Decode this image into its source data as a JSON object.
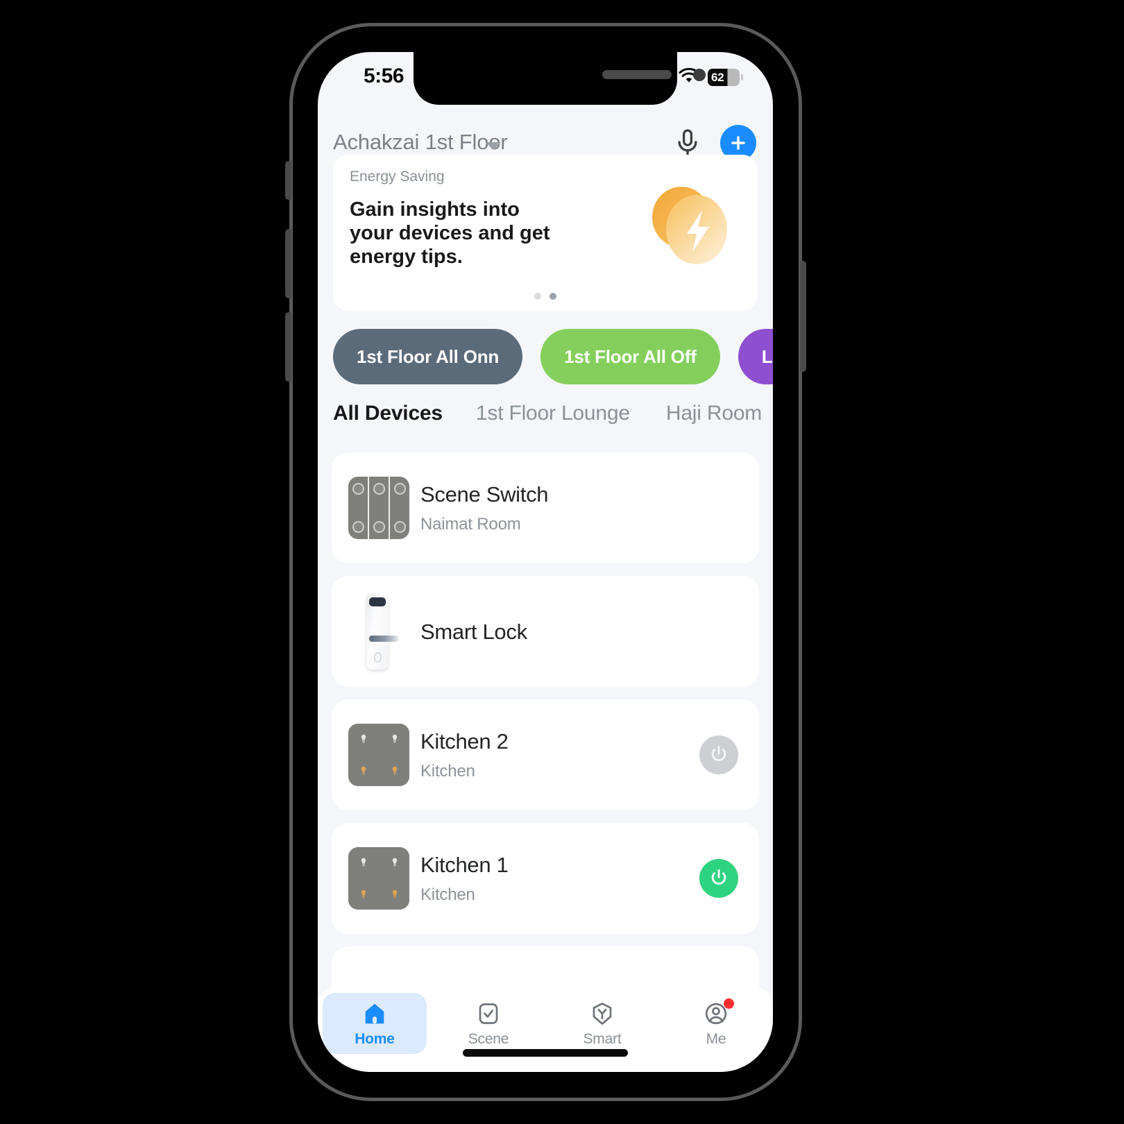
{
  "status_bar": {
    "time": "5:56",
    "location_icon": "location-arrow-icon",
    "wifi_icon": "wifi-icon",
    "battery_percent": "62"
  },
  "header": {
    "home_name": "Achakzai 1st Floor",
    "dropdown_icon": "chevron-down-icon",
    "mic_icon": "microphone-icon",
    "add_icon": "plus-icon"
  },
  "energy_card": {
    "kicker": "Energy Saving",
    "title": "Gain insights into your devices and get energy tips.",
    "art_icon": "energy-bolt-icon",
    "pager": {
      "count": 2,
      "active_index": 1
    }
  },
  "scenes": [
    {
      "label": "1st Floor All Onn",
      "color": "#5c6b7a"
    },
    {
      "label": "1st Floor All Off",
      "color": "#84cf5c"
    },
    {
      "label": "Lounge Onn",
      "color": "#8e4fd0"
    }
  ],
  "room_tabs": {
    "items": [
      {
        "label": "All Devices",
        "active": true
      },
      {
        "label": "1st Floor Lounge",
        "active": false
      },
      {
        "label": "Haji Room",
        "active": false
      }
    ],
    "more_icon": "ellipsis-icon"
  },
  "devices": [
    {
      "name": "Scene Switch",
      "room": "Naimat Room",
      "icon": "scene-switch-icon",
      "has_toggle": false,
      "toggle_state": ""
    },
    {
      "name": "Smart Lock",
      "room": "",
      "icon": "smart-lock-icon",
      "has_toggle": false,
      "toggle_state": ""
    },
    {
      "name": "Kitchen 2",
      "room": "Kitchen",
      "icon": "four-gang-switch-icon",
      "has_toggle": true,
      "toggle_state": "off"
    },
    {
      "name": "Kitchen 1",
      "room": "Kitchen",
      "icon": "four-gang-switch-icon",
      "has_toggle": true,
      "toggle_state": "on"
    }
  ],
  "bottom_nav": [
    {
      "label": "Home",
      "icon": "home-icon",
      "active": true,
      "badge": false
    },
    {
      "label": "Scene",
      "icon": "check-square-icon",
      "active": false,
      "badge": false
    },
    {
      "label": "Smart",
      "icon": "smart-hexagon-icon",
      "active": false,
      "badge": false
    },
    {
      "label": "Me",
      "icon": "account-icon",
      "active": false,
      "badge": true
    }
  ],
  "colors": {
    "accent_blue": "#1a8cff",
    "toggle_on_green": "#2ed37f",
    "toggle_off_gray": "#cdcfd2",
    "screen_bg": "#f4f6f9",
    "card_bg": "#ffffff"
  }
}
